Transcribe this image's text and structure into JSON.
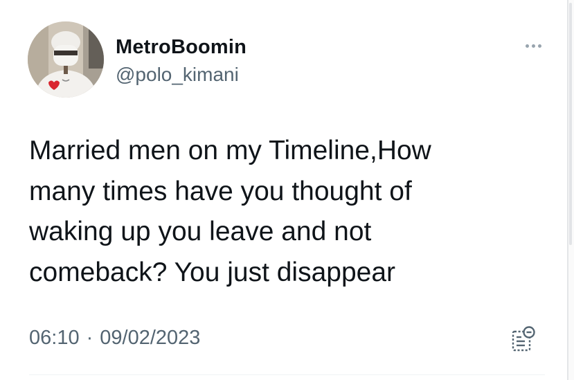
{
  "tweet": {
    "author": {
      "display_name": "MetroBoomin",
      "handle": "@polo_kimani"
    },
    "text_lines": [
      "Married men on my Timeline,How",
      "many times have you thought of",
      "waking up you leave and not",
      "comeback? You just disappear"
    ],
    "time": "06:10",
    "separator": "·",
    "date": "09/02/2023"
  },
  "icons": {
    "more": "more-options-icon",
    "analytics": "view-analytics-icon"
  },
  "colors": {
    "text_primary": "#0f1419",
    "text_secondary": "#536471",
    "icon_gray": "#98a4ae",
    "divider": "#eff3f4"
  }
}
